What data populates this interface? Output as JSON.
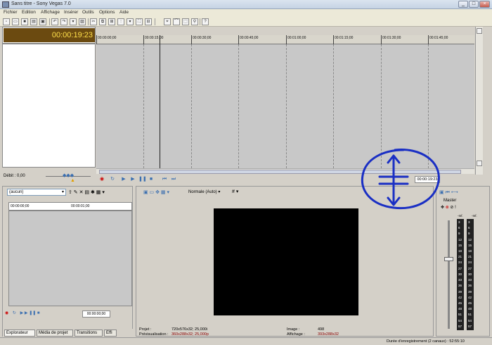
{
  "window": {
    "title": "Sans titre - Sony Vegas 7.0",
    "minimize": "_",
    "maximize": "□",
    "close": "×"
  },
  "menu": [
    "Fichier",
    "Edition",
    "Affichage",
    "Insérer",
    "Outils",
    "Options",
    "Aide"
  ],
  "timeline": {
    "current_time": "00:00:19:23",
    "ruler_ticks": [
      "00:00:00;00",
      "00:00:15;00",
      "00:00:30;00",
      "00:00:45;00",
      "00:01:00;00",
      "00:01:15;00",
      "00:01:30;00",
      "00:01:45;00"
    ],
    "cursor_time": "00:00:19:23",
    "debit_label": "Débit : 0,00",
    "warning_icon": "warning-icon"
  },
  "explorer": {
    "dropdown_value": "(aucun)",
    "ruler_ticks": [
      "00:00:00;00",
      "00:00:01;00"
    ],
    "time": "00:00:00;00",
    "tabs": [
      "Explorateur",
      "Média de projet",
      "Transitions",
      "Effi"
    ]
  },
  "preview": {
    "quality": "Normale (Auto)",
    "projet_label": "Projet :",
    "projet_value": "720x576x32; 25,000i",
    "previsualisation_label": "Prévisualisation :",
    "previsualisation_value": "360x288x32; 25,000p",
    "image_label": "Image :",
    "image_value": "498",
    "affichage_label": "Affichage :",
    "affichage_value": "393x288x32",
    "value_color": "#8b0000"
  },
  "mixer": {
    "master_label": "Master",
    "db_top_left": "-Inf.",
    "db_top_right": "-Inf.",
    "scale": [
      "3",
      "6",
      "9",
      "12",
      "15",
      "18",
      "21",
      "24",
      "27",
      "30",
      "33",
      "36",
      "39",
      "42",
      "45",
      "48",
      "51",
      "54",
      "57"
    ]
  },
  "status": {
    "recording": "Durée d'enregistrement (2 canaux) : 52:55:10"
  },
  "colors": {
    "timebox_bg": "#6b4a10",
    "timebox_fg": "#ffe04a",
    "annotation": "#1a2fc4"
  }
}
